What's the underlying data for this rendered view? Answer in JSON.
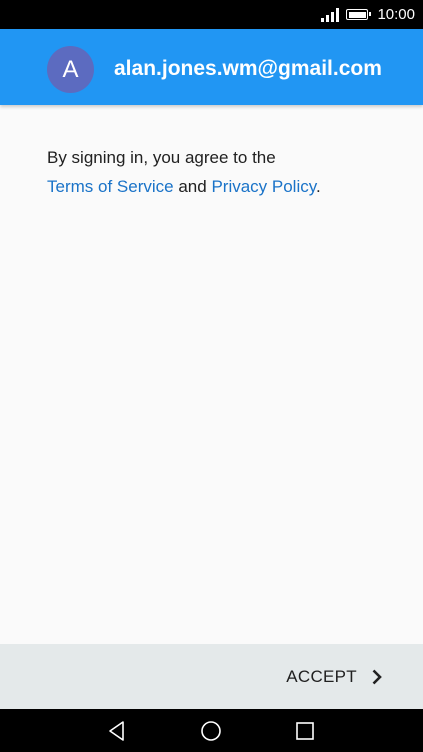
{
  "status_bar": {
    "time": "10:00",
    "icons": [
      "signal-icon",
      "battery-icon"
    ]
  },
  "header": {
    "avatar_letter": "A",
    "email": "alan.jones.wm@gmail.com",
    "colors": {
      "background": "#2196f3",
      "avatar": "#5c6bc0"
    }
  },
  "content": {
    "intro": "By signing in, you agree to the",
    "terms_link": "Terms of Service",
    "and": "and",
    "privacy_link": "Privacy Policy",
    "period": ".",
    "link_color": "#1a73c8"
  },
  "footer": {
    "accept_label": "ACCEPT",
    "accept_icon": "chevron-right-icon"
  },
  "nav_bar": {
    "icons": [
      "back-icon",
      "home-icon",
      "recents-icon"
    ]
  }
}
